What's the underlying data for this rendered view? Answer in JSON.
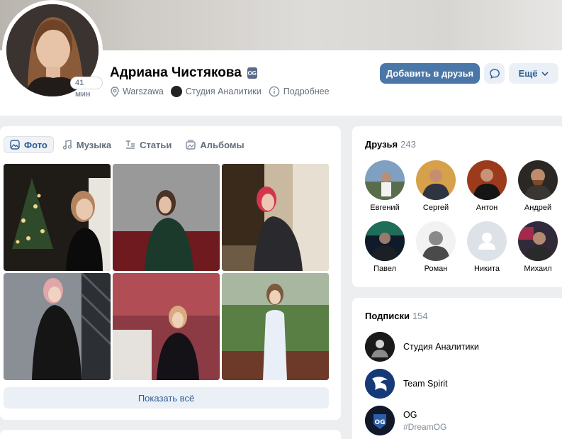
{
  "profile": {
    "name": "Адриана Чистякова",
    "badge": "OG",
    "online": "41 мин",
    "location": "Warszawa",
    "workplace": "Студия Аналитики",
    "more_info": "Подробнее"
  },
  "actions": {
    "add_friend": "Добавить в друзья",
    "more": "Ещё"
  },
  "tabs": [
    {
      "label": "Фото",
      "icon": "photo-icon",
      "active": true
    },
    {
      "label": "Музыка",
      "icon": "music-note-icon",
      "active": false
    },
    {
      "label": "Статьи",
      "icon": "articles-icon",
      "active": false
    },
    {
      "label": "Альбомы",
      "icon": "albums-icon",
      "active": false
    }
  ],
  "photos": {
    "show_all": "Показать всё"
  },
  "friends": {
    "title": "Друзья",
    "count": "243",
    "items": [
      {
        "name": "Евгений"
      },
      {
        "name": "Сергей"
      },
      {
        "name": "Антон"
      },
      {
        "name": "Андрей"
      },
      {
        "name": "Павел"
      },
      {
        "name": "Роман"
      },
      {
        "name": "Никита"
      },
      {
        "name": "Михаил"
      }
    ]
  },
  "subscriptions": {
    "title": "Подписки",
    "count": "154",
    "items": [
      {
        "name": "Студия Аналитики",
        "desc": ""
      },
      {
        "name": "Team Spirit",
        "desc": ""
      },
      {
        "name": "OG",
        "desc": "#DreamOG"
      }
    ]
  },
  "colors": {
    "accent": "#4a76a8",
    "link": "#2c5d93",
    "secondary_bg": "#ebf0f6",
    "page_bg": "#edeef0"
  }
}
